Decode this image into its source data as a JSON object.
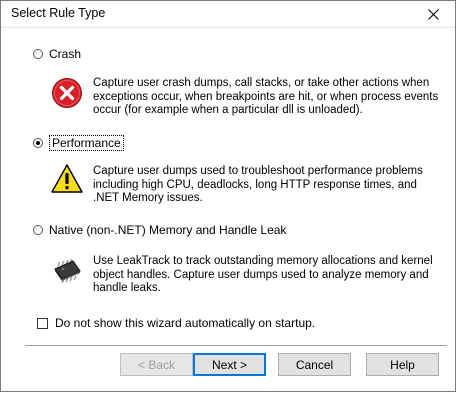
{
  "window": {
    "title": "Select Rule Type"
  },
  "options": [
    {
      "label": "Crash",
      "checked": false,
      "icon": "error-icon",
      "description": "Capture user crash dumps, call stacks, or take other actions when exceptions occur, when breakpoints are hit, or when process events occur (for example when a particular dll is unloaded)."
    },
    {
      "label": "Performance",
      "checked": true,
      "icon": "warning-icon",
      "description": "Capture user dumps used to troubleshoot performance problems including high CPU, deadlocks, long HTTP response times, and .NET Memory issues."
    },
    {
      "label": "Native (non-.NET) Memory and Handle Leak",
      "checked": false,
      "icon": "chip-icon",
      "description": "Use LeakTrack to track outstanding memory allocations and kernel object handles. Capture user dumps used to analyze memory and handle leaks."
    }
  ],
  "startup_checkbox": {
    "label": "Do not show this wizard automatically on startup.",
    "checked": false
  },
  "buttons": {
    "back": "< Back",
    "next": "Next >",
    "cancel": "Cancel",
    "help": "Help"
  }
}
